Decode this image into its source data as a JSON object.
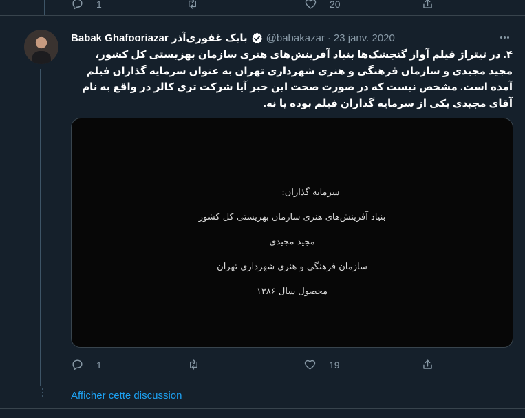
{
  "colors": {
    "background": "#15202b",
    "accent": "#1da1f2",
    "muted": "#8899a6",
    "divider": "#38444d"
  },
  "previous_tweet": {
    "reply_count": "1",
    "retweet_count": "",
    "like_count": "20"
  },
  "tweet": {
    "display_name": "Babak Ghafooriazar بابک غفوری‌آذر",
    "handle": "@babakazar",
    "separator": "·",
    "date": "23 janv. 2020",
    "text": "۴. در تیتراژ فیلم آواز گنجشک‌ها بنیاد آفرینش‌های هنری سازمان بهزیستی کل کشور، مجید مجیدی و سازمان فرهنگی و هنری شهرداری تهران به عنوان سرمایه گذاران فیلم آمده است. مشخص نیست که در صورت صحت این خبر آیا شرکت تری کالر در واقع به نام آقای مجیدی یکی از سرمایه گذاران فیلم بوده یا نه.",
    "media_credits": [
      "سرمایه گذاران:",
      "بنیاد آفرینش‌های هنری سازمان بهزیستی کل کشور",
      "مجید مجیدی",
      "سازمان فرهنگی و هنری شهرداری تهران",
      "محصول سال ۱۳۸۶"
    ],
    "reply_count": "1",
    "retweet_count": "",
    "like_count": "19"
  },
  "show_thread_label": "Afficher cette discussion",
  "icons": [
    "reply-icon",
    "retweet-icon",
    "like-icon",
    "share-icon",
    "verified-icon",
    "more-icon"
  ]
}
